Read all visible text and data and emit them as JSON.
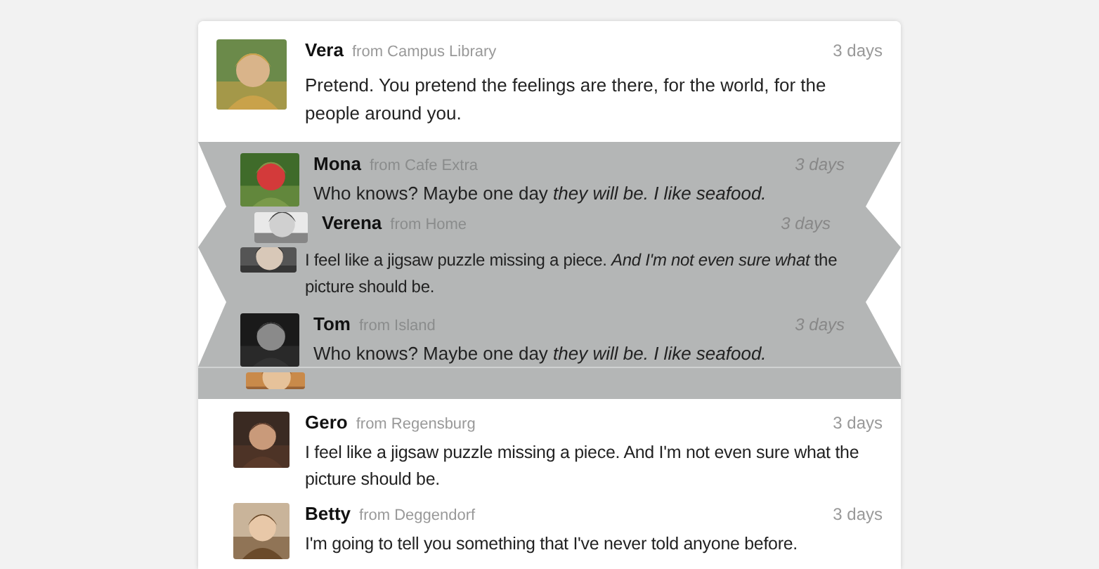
{
  "messages": [
    {
      "kind": "card",
      "name": "Vera",
      "from": "from Campus Library",
      "time": "3 days",
      "text": "Pretend. You pretend the feelings are there, for the world, for the people around you."
    },
    {
      "kind": "folded",
      "name": "Mona",
      "from": "from Cafe Extra",
      "time": "3 days",
      "text": "Who knows? Maybe one day *they will be. I like seafood.*"
    },
    {
      "kind": "folded-header",
      "name": "Verena",
      "from": "from Home",
      "time": "3 days"
    },
    {
      "kind": "folded-body",
      "text": "I feel like a jigsaw puzzle missing a piece. *And I'm not even sure what* the picture should be."
    },
    {
      "kind": "folded",
      "name": "Tom",
      "from": "from Island",
      "time": "3 days",
      "text": "Who knows? Maybe one day *they will be. I like seafood.*"
    },
    {
      "kind": "folded-avatar"
    },
    {
      "kind": "card",
      "name": "Gero",
      "from": "from Regensburg",
      "time": "3 days",
      "text": "I feel like a jigsaw puzzle missing a piece. And I'm not even sure what the picture should be."
    },
    {
      "kind": "card",
      "name": "Betty",
      "from": "from Deggendorf",
      "time": "3 days",
      "text": "I'm going to tell you something that I've never told anyone before."
    }
  ]
}
